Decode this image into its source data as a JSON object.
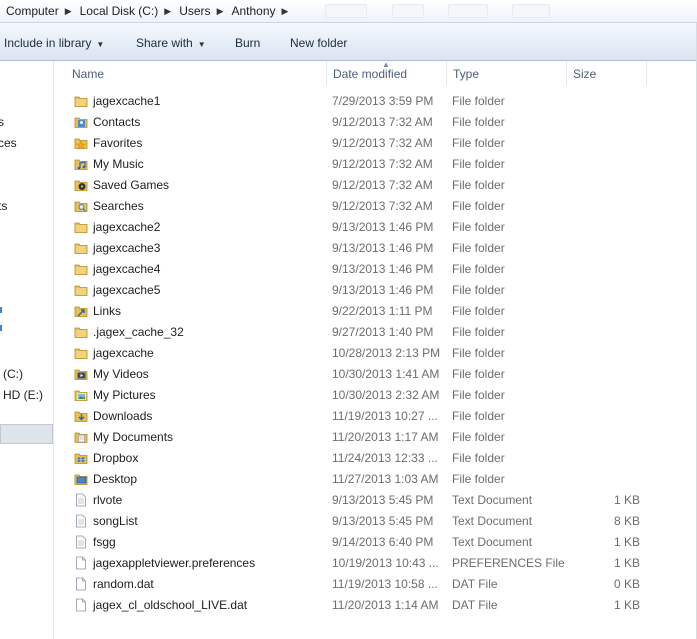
{
  "address": {
    "crumbs": [
      "Computer",
      "Local Disk (C:)",
      "Users",
      "Anthony"
    ]
  },
  "toolbar": {
    "include_label": "Include in library",
    "share_label": "Share with",
    "burn_label": "Burn",
    "new_folder_label": "New folder"
  },
  "nav": {
    "fragments": [
      "s",
      "ces",
      "ts",
      "(C:)",
      "HD (E:)"
    ]
  },
  "columns": {
    "name": "Name",
    "date": "Date modified",
    "type": "Type",
    "size": "Size"
  },
  "files": [
    {
      "name": "jagexcache1",
      "date": "7/29/2013 3:59 PM",
      "type": "File folder",
      "size": "",
      "icon": "folder-icon"
    },
    {
      "name": "Contacts",
      "date": "9/12/2013 7:32 AM",
      "type": "File folder",
      "size": "",
      "icon": "contacts-folder-icon"
    },
    {
      "name": "Favorites",
      "date": "9/12/2013 7:32 AM",
      "type": "File folder",
      "size": "",
      "icon": "favorites-folder-icon"
    },
    {
      "name": "My Music",
      "date": "9/12/2013 7:32 AM",
      "type": "File folder",
      "size": "",
      "icon": "music-folder-icon"
    },
    {
      "name": "Saved Games",
      "date": "9/12/2013 7:32 AM",
      "type": "File folder",
      "size": "",
      "icon": "saved-games-folder-icon"
    },
    {
      "name": "Searches",
      "date": "9/12/2013 7:32 AM",
      "type": "File folder",
      "size": "",
      "icon": "searches-folder-icon"
    },
    {
      "name": "jagexcache2",
      "date": "9/13/2013 1:46 PM",
      "type": "File folder",
      "size": "",
      "icon": "folder-icon"
    },
    {
      "name": "jagexcache3",
      "date": "9/13/2013 1:46 PM",
      "type": "File folder",
      "size": "",
      "icon": "folder-icon"
    },
    {
      "name": "jagexcache4",
      "date": "9/13/2013 1:46 PM",
      "type": "File folder",
      "size": "",
      "icon": "folder-icon"
    },
    {
      "name": "jagexcache5",
      "date": "9/13/2013 1:46 PM",
      "type": "File folder",
      "size": "",
      "icon": "folder-icon"
    },
    {
      "name": "Links",
      "date": "9/22/2013 1:11 PM",
      "type": "File folder",
      "size": "",
      "icon": "links-folder-icon"
    },
    {
      "name": ".jagex_cache_32",
      "date": "9/27/2013 1:40 PM",
      "type": "File folder",
      "size": "",
      "icon": "folder-icon"
    },
    {
      "name": "jagexcache",
      "date": "10/28/2013 2:13 PM",
      "type": "File folder",
      "size": "",
      "icon": "folder-icon"
    },
    {
      "name": "My Videos",
      "date": "10/30/2013 1:41 AM",
      "type": "File folder",
      "size": "",
      "icon": "videos-folder-icon"
    },
    {
      "name": "My Pictures",
      "date": "10/30/2013 2:32 AM",
      "type": "File folder",
      "size": "",
      "icon": "pictures-folder-icon"
    },
    {
      "name": "Downloads",
      "date": "11/19/2013 10:27 ...",
      "type": "File folder",
      "size": "",
      "icon": "downloads-folder-icon"
    },
    {
      "name": "My Documents",
      "date": "11/20/2013 1:17 AM",
      "type": "File folder",
      "size": "",
      "icon": "documents-folder-icon"
    },
    {
      "name": "Dropbox",
      "date": "11/24/2013 12:33 ...",
      "type": "File folder",
      "size": "",
      "icon": "dropbox-folder-icon"
    },
    {
      "name": "Desktop",
      "date": "11/27/2013 1:03 AM",
      "type": "File folder",
      "size": "",
      "icon": "desktop-folder-icon"
    },
    {
      "name": "rlvote",
      "date": "9/13/2013 5:45 PM",
      "type": "Text Document",
      "size": "1 KB",
      "icon": "text-document-icon"
    },
    {
      "name": "songList",
      "date": "9/13/2013 5:45 PM",
      "type": "Text Document",
      "size": "8 KB",
      "icon": "text-document-icon"
    },
    {
      "name": "fsgg",
      "date": "9/14/2013 6:40 PM",
      "type": "Text Document",
      "size": "1 KB",
      "icon": "text-document-icon"
    },
    {
      "name": "jagexappletviewer.preferences",
      "date": "10/19/2013 10:43 ...",
      "type": "PREFERENCES File",
      "size": "1 KB",
      "icon": "file-icon"
    },
    {
      "name": "random.dat",
      "date": "11/19/2013 10:58 ...",
      "type": "DAT File",
      "size": "0 KB",
      "icon": "file-icon"
    },
    {
      "name": "jagex_cl_oldschool_LIVE.dat",
      "date": "11/20/2013 1:14 AM",
      "type": "DAT File",
      "size": "1 KB",
      "icon": "file-icon"
    }
  ]
}
